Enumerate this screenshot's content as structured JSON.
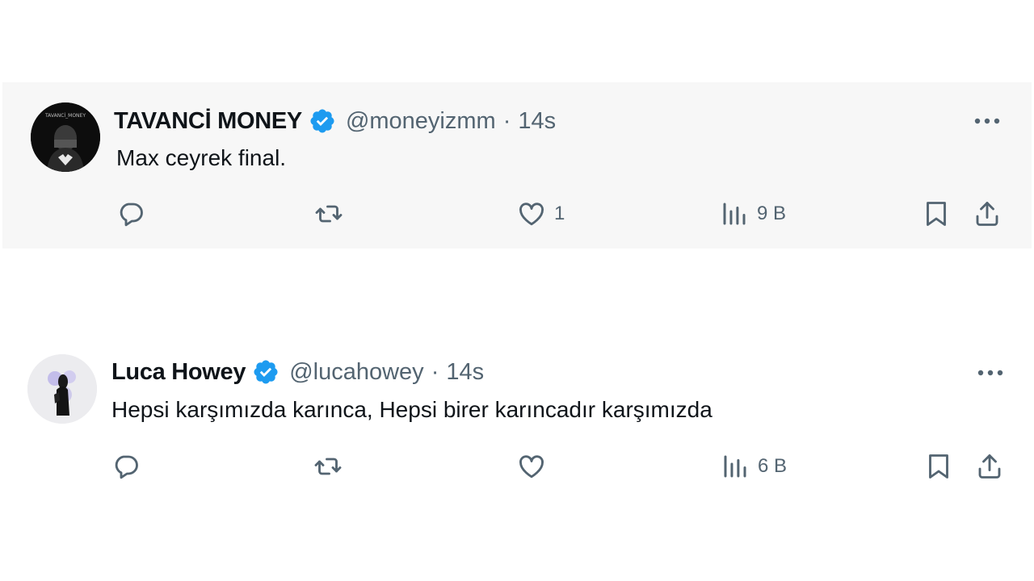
{
  "tweets": [
    {
      "name": "TAVANCİ MONEY",
      "handle": "@moneyizmm",
      "separator": "·",
      "time": "14s",
      "text": "Max ceyrek final.",
      "likes": "1",
      "views": "9 B",
      "avatar_text": "TAVANCİ_MONEY"
    },
    {
      "name": "Luca Howey",
      "handle": "@lucahowey",
      "separator": "·",
      "time": "14s",
      "text": "Hepsi karşımızda karınca, Hepsi birer karıncadır karşımızda",
      "likes": "",
      "views": "6 B"
    }
  ],
  "icons": {
    "verified": "verified-badge-icon",
    "more": "more-horizontal-icon",
    "reply": "reply-icon",
    "retweet": "retweet-icon",
    "like": "heart-icon",
    "views": "views-chart-icon",
    "bookmark": "bookmark-icon",
    "share": "share-icon"
  },
  "colors": {
    "verified": "#1d9bf0",
    "secondary_text": "#536471",
    "primary_text": "#0f1419"
  }
}
